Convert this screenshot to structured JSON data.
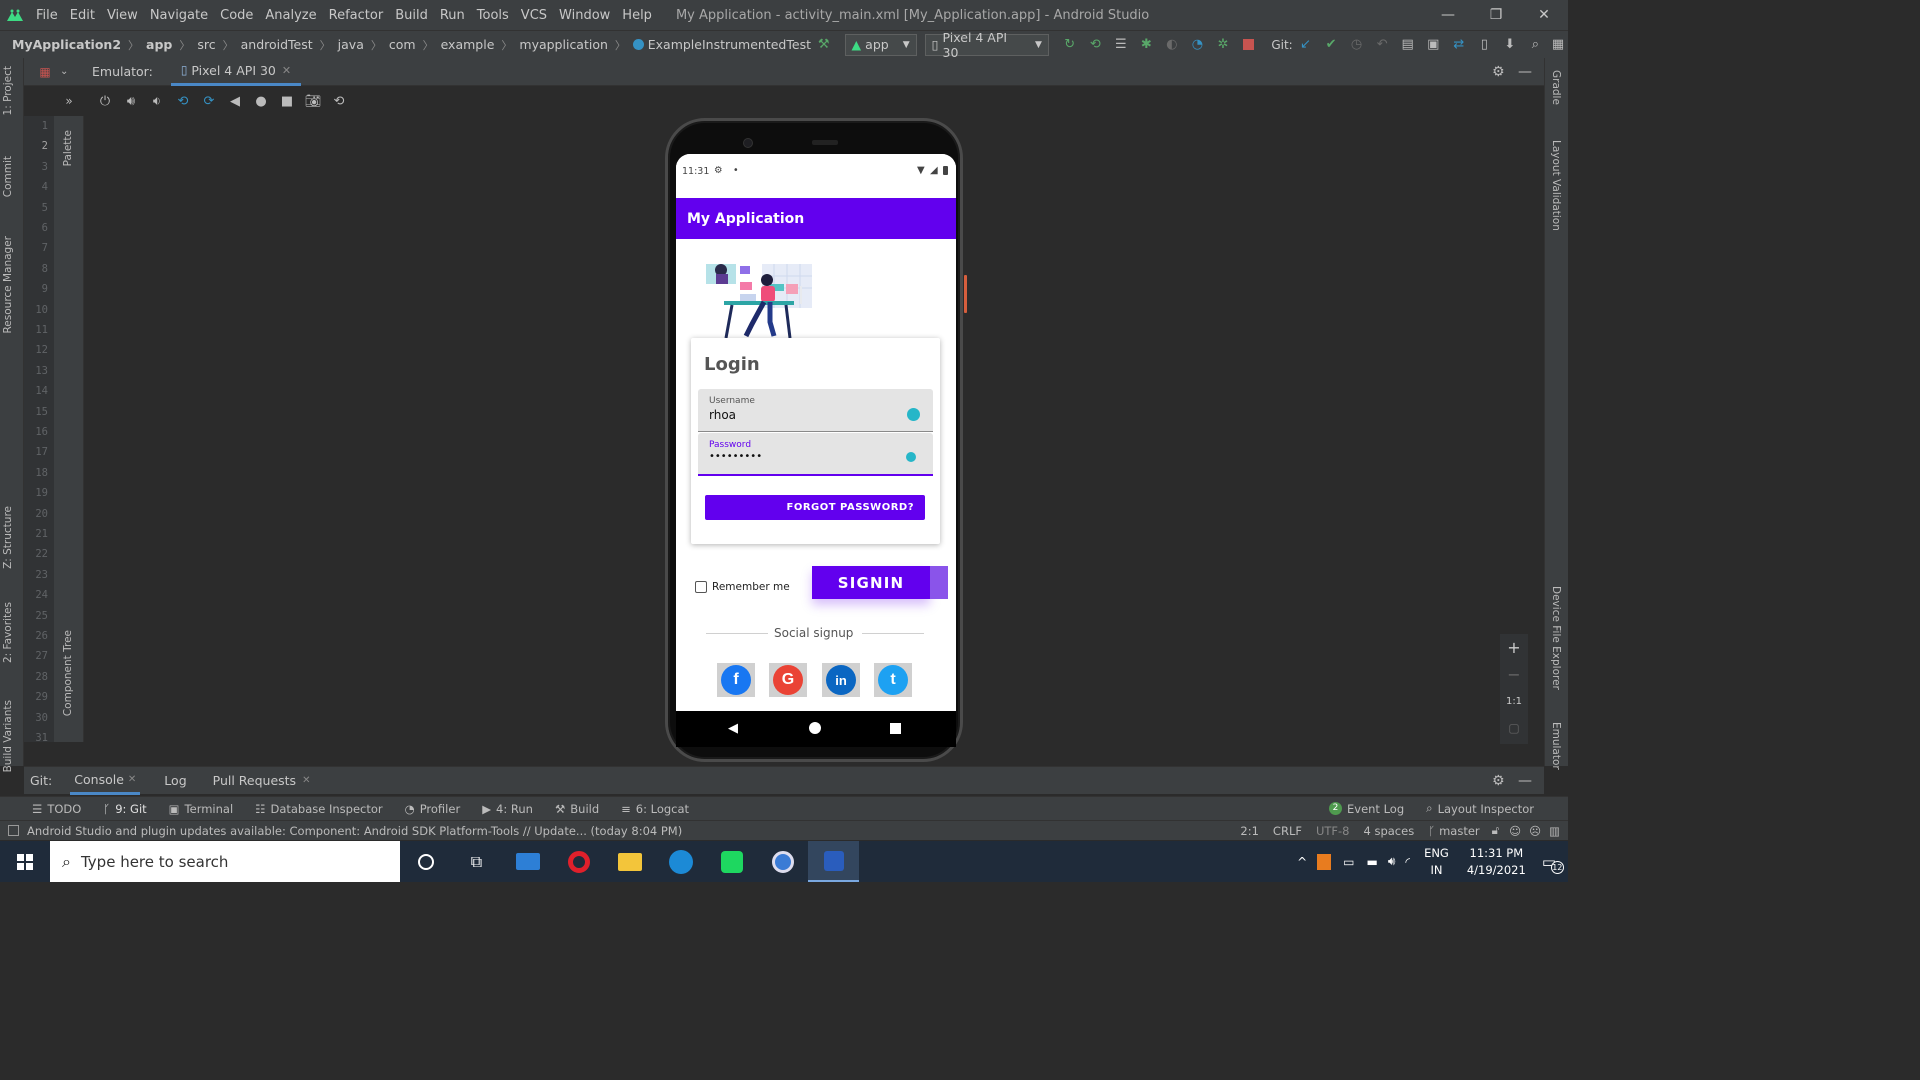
{
  "menu": {
    "items": [
      "File",
      "Edit",
      "View",
      "Navigate",
      "Code",
      "Analyze",
      "Refactor",
      "Build",
      "Run",
      "Tools",
      "VCS",
      "Window",
      "Help"
    ],
    "window_title": "My Application - activity_main.xml [My_Application.app] - Android Studio"
  },
  "nav": {
    "crumbs": [
      "MyApplication2",
      "app",
      "src",
      "androidTest",
      "java",
      "com",
      "example",
      "myapplication",
      "ExampleInstrumentedTest"
    ],
    "config_dropdown": "app",
    "device_dropdown": "Pixel 4 API 30",
    "git_label": "Git:"
  },
  "emulator": {
    "label": "Emulator:",
    "tab": "Pixel 4 API 30"
  },
  "left_tabs": [
    "1: Project",
    "Commit",
    "Resource Manager",
    "Z: Structure",
    "2: Favorites",
    "Build Variants"
  ],
  "right_tabs": [
    "Gradle",
    "Layout Validation",
    "Device File Explorer",
    "Emulator"
  ],
  "palette_tabs": [
    "Palette",
    "Component Tree"
  ],
  "line_numbers": [
    "1",
    "2",
    "3",
    "4",
    "5",
    "6",
    "7",
    "8",
    "9",
    "10",
    "11",
    "12",
    "13",
    "14",
    "15",
    "16",
    "17",
    "18",
    "19",
    "20",
    "21",
    "22",
    "23",
    "24",
    "25",
    "26",
    "27",
    "28",
    "29",
    "30",
    "31"
  ],
  "phone": {
    "time": "11:31",
    "app_title": "My Application",
    "login_title": "Login",
    "username_label": "Username",
    "username_value": "rhoa",
    "password_label": "Password",
    "password_value": "•••••••••",
    "forgot_label": "FORGOT PASSWORD?",
    "remember_label": "Remember me",
    "signin_label": "SIGNIN",
    "social_label": "Social signup",
    "social": [
      {
        "name": "facebook",
        "glyph": "f",
        "color": "#1877f2"
      },
      {
        "name": "google",
        "glyph": "G",
        "color": "#ea4335"
      },
      {
        "name": "linkedin",
        "glyph": "in",
        "color": "#0a66c2"
      },
      {
        "name": "twitter",
        "glyph": "t",
        "color": "#1da1f2"
      }
    ]
  },
  "zoom": {
    "fit": "1:1"
  },
  "bottom_tabs": {
    "git": "Git:",
    "console": "Console",
    "log": "Log",
    "pull_requests": "Pull Requests"
  },
  "tool_windows": {
    "todo": "TODO",
    "git": "9: Git",
    "terminal": "Terminal",
    "database": "Database Inspector",
    "profiler": "Profiler",
    "run": "4: Run",
    "build": "Build",
    "logcat": "6: Logcat",
    "event_log_count": "2",
    "event_log": "Event Log",
    "layout_inspector": "Layout Inspector"
  },
  "status": {
    "message": "Android Studio and plugin updates available: Component: Android SDK Platform-Tools // Update... (today 8:04 PM)",
    "position": "2:1",
    "line_sep": "CRLF",
    "encoding": "UTF-8",
    "indent": "4 spaces",
    "branch": "master"
  },
  "taskbar": {
    "search_placeholder": "Type here to search",
    "lang_top": "ENG",
    "lang_bottom": "IN",
    "time": "11:31 PM",
    "date": "4/19/2021",
    "notif_count": "12"
  },
  "colors": {
    "accent": "#6200ee",
    "ide_bg": "#2b2b2b",
    "ide_panel": "#3c3f41"
  }
}
